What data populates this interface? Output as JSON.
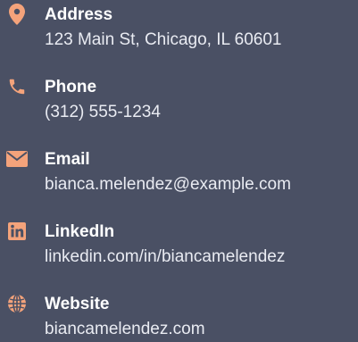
{
  "colors": {
    "background": "#4a5064",
    "accent": "#f4a37b",
    "label": "#ffffff",
    "value": "#e9ebf2"
  },
  "contacts": [
    {
      "icon": "map-pin-icon",
      "label": "Address",
      "value": "123 Main St, Chicago, IL 60601"
    },
    {
      "icon": "phone-icon",
      "label": "Phone",
      "value": "(312) 555-1234"
    },
    {
      "icon": "envelope-icon",
      "label": "Email",
      "value": "bianca.melendez@example.com"
    },
    {
      "icon": "linkedin-icon",
      "label": "LinkedIn",
      "value": "linkedin.com/in/biancamelendez"
    },
    {
      "icon": "globe-icon",
      "label": "Website",
      "value": "biancamelendez.com"
    }
  ]
}
